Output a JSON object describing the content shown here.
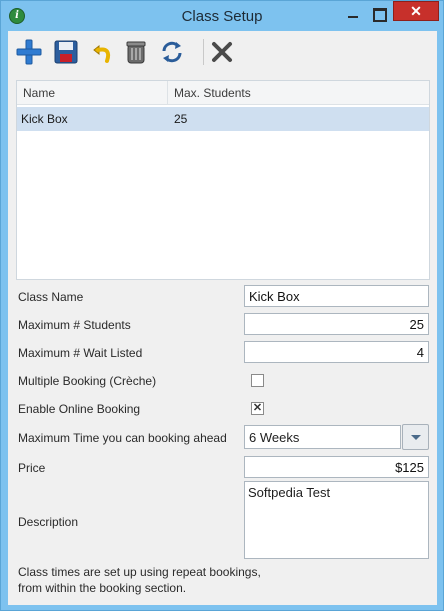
{
  "window": {
    "title": "Class Setup",
    "close_glyph": "✕"
  },
  "toolbar": {
    "buttons": [
      "add-icon",
      "save-icon",
      "undo-icon",
      "delete-icon",
      "refresh-icon",
      "cancel-icon"
    ]
  },
  "grid": {
    "columns": [
      "Name",
      "Max. Students"
    ],
    "rows": [
      {
        "name": "Kick Box",
        "max_students": "25"
      }
    ]
  },
  "form": {
    "class_name_label": "Class Name",
    "class_name_value": "Kick Box",
    "max_students_label": "Maximum # Students",
    "max_students_value": "25",
    "max_wait_label": "Maximum # Wait Listed",
    "max_wait_value": "4",
    "multiple_booking_label": "Multiple Booking (Crèche)",
    "multiple_booking_checked": false,
    "online_booking_label": "Enable Online Booking",
    "online_booking_checked": true,
    "online_booking_mark": "✕",
    "max_time_label": "Maximum Time you can booking ahead",
    "max_time_value": "6 Weeks",
    "price_label": "Price",
    "price_value": "$125",
    "description_label": "Description",
    "description_value": "Softpedia Test",
    "note": "Class times are set up using repeat bookings, from within the booking section."
  }
}
